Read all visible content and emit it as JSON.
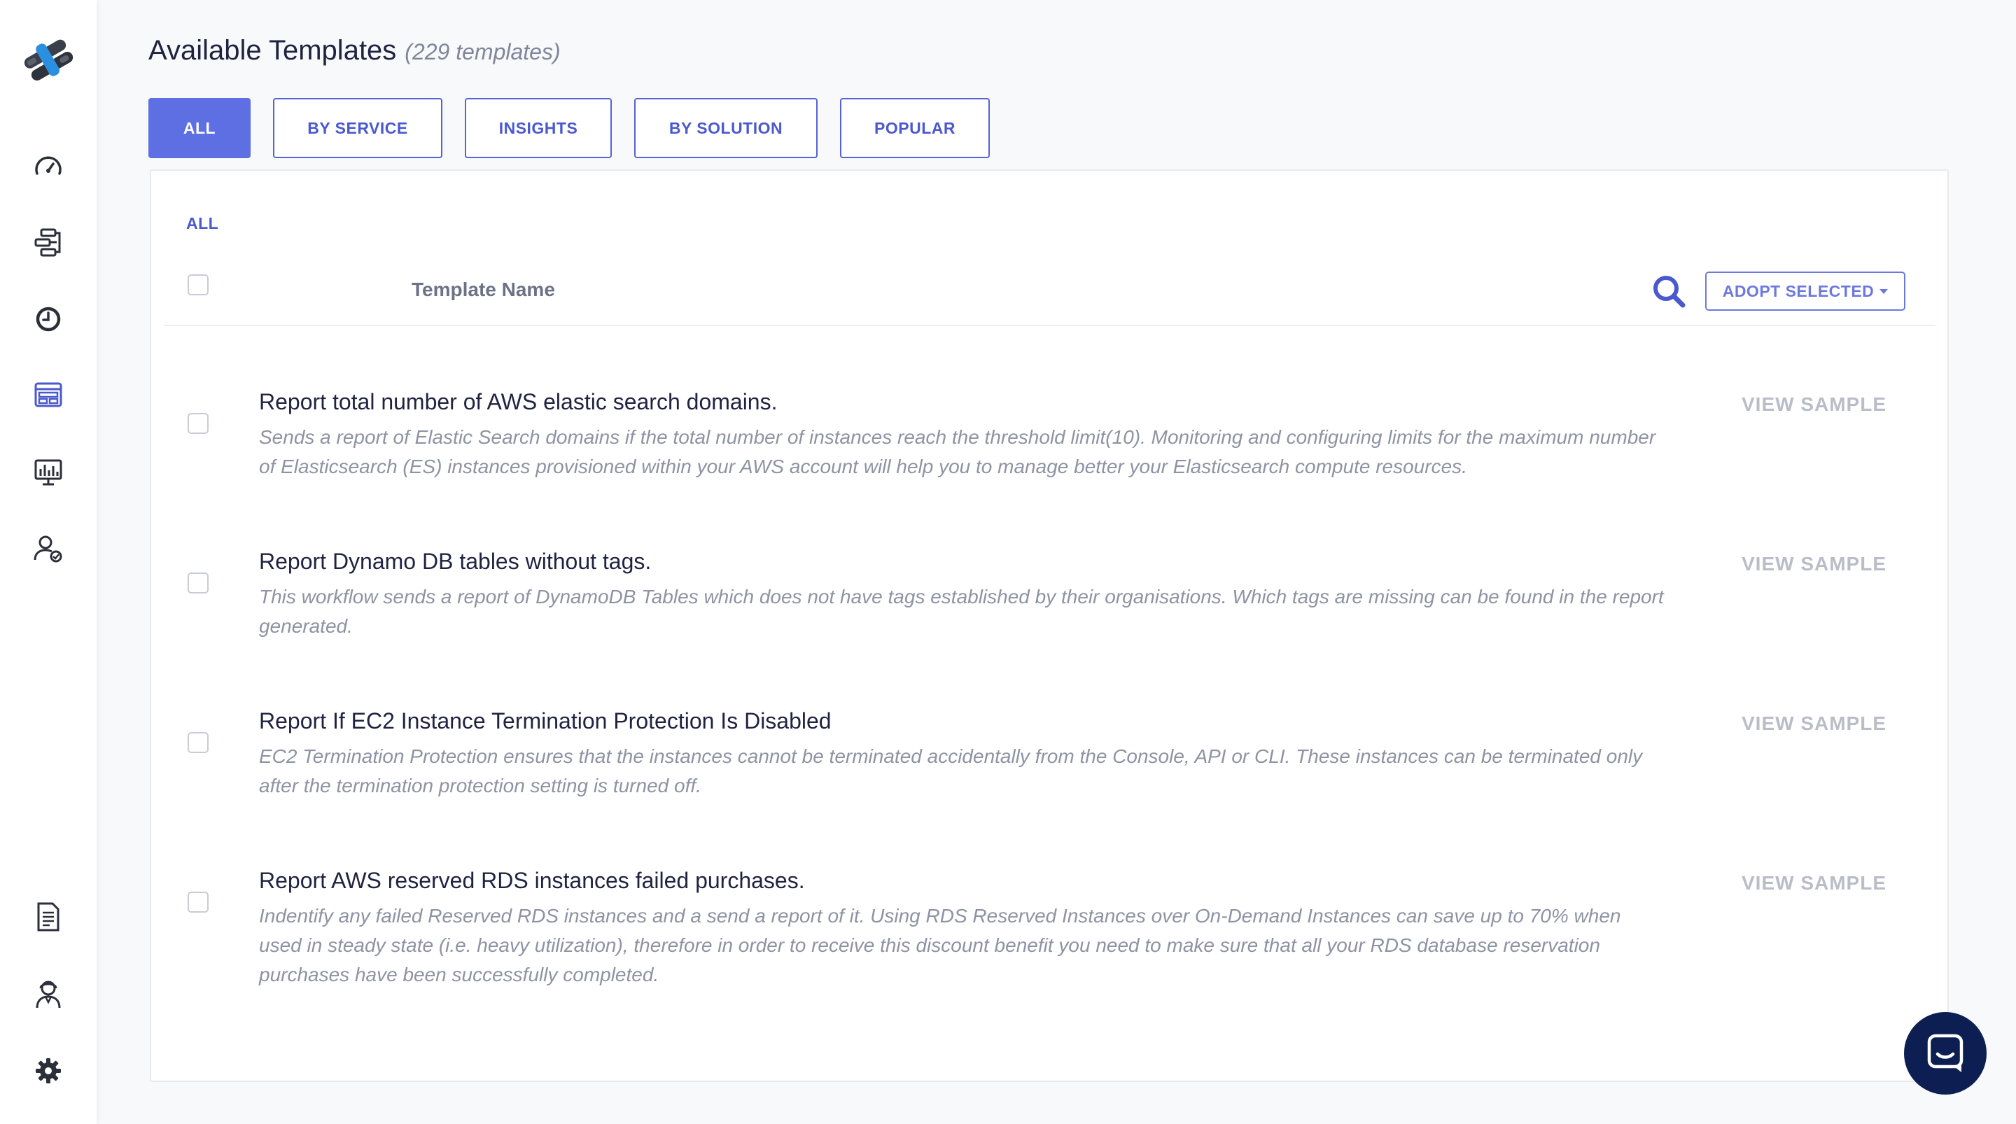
{
  "header": {
    "title": "Available Templates",
    "count": "(229 templates)"
  },
  "tabs": [
    {
      "label": "ALL",
      "active": true
    },
    {
      "label": "BY SERVICE",
      "active": false
    },
    {
      "label": "INSIGHTS",
      "active": false
    },
    {
      "label": "BY SOLUTION",
      "active": false
    },
    {
      "label": "POPULAR",
      "active": false
    }
  ],
  "panel": {
    "filter_label": "ALL",
    "column_header": "Template Name",
    "adopt_button": "ADOPT SELECTED"
  },
  "templates": [
    {
      "title": "Report total number of AWS elastic search domains.",
      "description": "Sends a report of Elastic Search domains if the total number of instances reach the threshold limit(10). Monitoring and configuring limits for the maximum number of Elasticsearch (ES) instances provisioned within your AWS account will help you to manage better your Elasticsearch compute resources.",
      "action": "VIEW SAMPLE"
    },
    {
      "title": "Report Dynamo DB tables without tags.",
      "description": "This workflow sends a report of DynamoDB Tables which does not have tags established by their organisations. Which tags are missing can be found in the report generated.",
      "action": "VIEW SAMPLE"
    },
    {
      "title": "Report If EC2 Instance Termination Protection Is Disabled",
      "description": "EC2 Termination Protection ensures that the instances cannot be terminated accidentally from the Console, API or CLI. These instances can be terminated only after the termination protection setting is turned off.",
      "action": "VIEW SAMPLE"
    },
    {
      "title": "Report AWS reserved RDS instances failed purchases.",
      "description": "Indentify any failed Reserved RDS instances and a send a report of it. Using RDS Reserved Instances over On-Demand Instances can save up to 70% when used in steady state (i.e. heavy utilization), therefore in order to receive this discount benefit you need to make sure that all your RDS database reservation purchases have been successfully completed.",
      "action": "VIEW SAMPLE"
    }
  ],
  "sidebar": {
    "icons": [
      "dashboard-icon",
      "workflows-icon",
      "history-icon",
      "templates-icon",
      "insights-icon",
      "users-icon",
      "docs-icon",
      "support-icon",
      "settings-icon"
    ]
  },
  "colors": {
    "accent": "#5e6ee3",
    "text": "#1f2340",
    "muted": "#8e93a3",
    "chat": "#0d1e52"
  }
}
